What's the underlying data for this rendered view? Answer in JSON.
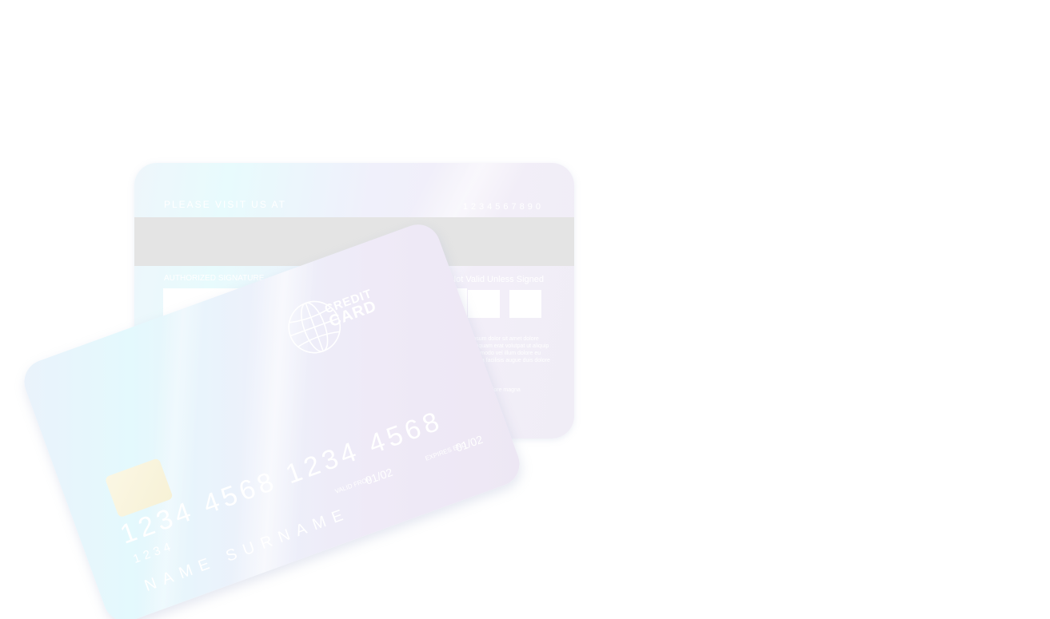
{
  "card_back": {
    "visit_text": "PLEASE VISIT US AT",
    "phone": "1234567890",
    "authorized_signature": "AUTHORIZED SIGNATURE",
    "not_valid_text": "Not Valid Unless Signed",
    "fine_print": "Lorem ipsum dolor sit amet dolore magna aliquam erat volutpat ut aliquip ex ea commodo vel illum dolore eu feugiat nulla facilisis augue duis dolore te",
    "fine_print_2": "dolore magna"
  },
  "card_front": {
    "logo_line1": "CREDIT",
    "logo_line2": "CARD",
    "number": "1234  4568  1234  4568",
    "small_number": "1234",
    "valid_label": "VALID FROM",
    "valid_date": "01/02",
    "expires_label": "EXPIRES END",
    "expires_date": "01/02",
    "holder_name": "NAME SURNAME",
    "logo_icon": "globe-icon",
    "chip_icon": "chip-icon"
  },
  "colors": {
    "background": "#ffffff",
    "card_cyan": "#e4f9fd",
    "card_lavender": "#ede7f4",
    "stripe": "#e4e4e4",
    "chip": "#f7f1d6"
  }
}
